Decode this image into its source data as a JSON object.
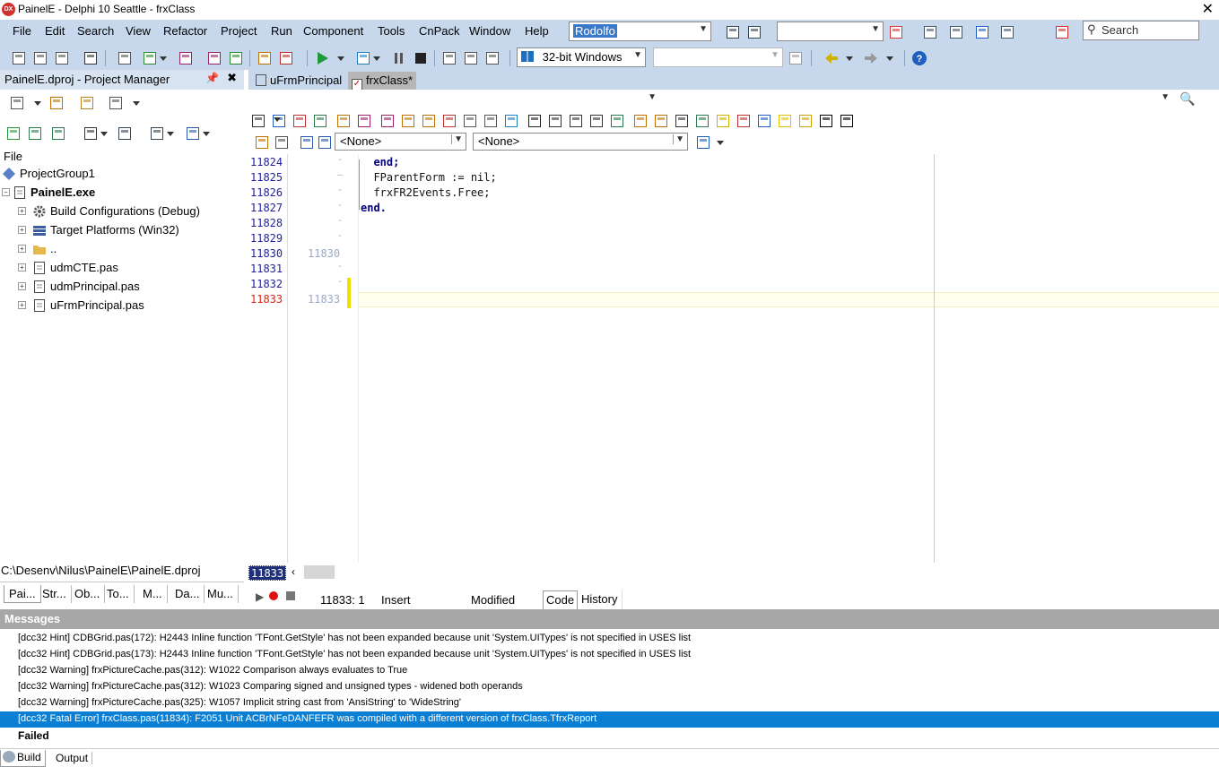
{
  "window": {
    "title": "PainelE - Delphi 10 Seattle - frxClass",
    "logo": "DX",
    "close_glyph": "✕"
  },
  "menu": [
    "File",
    "Edit",
    "Search",
    "View",
    "Refactor",
    "Project",
    "Run",
    "Component",
    "Tools",
    "CnPack",
    "Window",
    "Help"
  ],
  "toolbar": {
    "user_combo": "Rodolfo",
    "platform_combo": "32-bit Windows",
    "search_placeholder": "Search",
    "search_icon": "magnifier-icon"
  },
  "project_manager": {
    "title": "PainelE.dproj - Project Manager",
    "tree_header": "File",
    "tree": [
      {
        "label": "ProjectGroup1",
        "level": 0,
        "bold": false,
        "icon": "project-group-icon"
      },
      {
        "label": "PainelE.exe",
        "level": 1,
        "bold": true,
        "icon": "exe-icon"
      },
      {
        "label": "Build Configurations (Debug)",
        "level": 2,
        "bold": false,
        "icon": "gear-icon"
      },
      {
        "label": "Target Platforms (Win32)",
        "level": 2,
        "bold": false,
        "icon": "platform-icon"
      },
      {
        "label": "..",
        "level": 2,
        "bold": false,
        "icon": "folder-icon"
      },
      {
        "label": "udmCTE.pas",
        "level": 2,
        "bold": false,
        "icon": "pas-file-icon"
      },
      {
        "label": "udmPrincipal.pas",
        "level": 2,
        "bold": false,
        "icon": "pas-file-icon"
      },
      {
        "label": "uFrmPrincipal.pas",
        "level": 2,
        "bold": false,
        "icon": "pas-file-icon"
      }
    ],
    "path": "C:\\Desenv\\Nilus\\PainelE\\PainelE.dproj",
    "tabs": [
      "Pai...",
      "Str...",
      "Ob...",
      "To...",
      "M...",
      "Da...",
      "Mu..."
    ]
  },
  "editor": {
    "tabs": [
      {
        "label": "uFrmPrincipal",
        "active": false
      },
      {
        "label": "frxClass*",
        "active": true
      }
    ],
    "combo_intf": "<None>",
    "combo_impl": "<None>",
    "lines": [
      {
        "num": "11824",
        "text": "  end;",
        "kw": true,
        "indicator": "-",
        "alt": ""
      },
      {
        "num": "11825",
        "text": "  FParentForm := nil;",
        "kw": false,
        "indicator": "–",
        "alt": ""
      },
      {
        "num": "11826",
        "text": "  frxFR2Events.Free;",
        "kw": false,
        "indicator": "-",
        "alt": ""
      },
      {
        "num": "11827",
        "text": "end.",
        "kw": true,
        "indicator": "-",
        "alt": ""
      },
      {
        "num": "11828",
        "text": "",
        "kw": false,
        "indicator": "-",
        "alt": ""
      },
      {
        "num": "11829",
        "text": "",
        "kw": false,
        "indicator": "-",
        "alt": ""
      },
      {
        "num": "11830",
        "text": "",
        "kw": false,
        "indicator": "",
        "alt": "11830"
      },
      {
        "num": "11831",
        "text": "",
        "kw": false,
        "indicator": "-",
        "alt": ""
      },
      {
        "num": "11832",
        "text": "",
        "kw": false,
        "indicator": "-",
        "alt": ""
      },
      {
        "num": "11833",
        "text": "",
        "kw": false,
        "indicator": "",
        "alt": "11833"
      }
    ],
    "current_line_box": "11833",
    "status": {
      "position": "11833:   1",
      "mode": "Insert",
      "modified": "Modified",
      "tab_code": "Code",
      "tab_history": "History"
    }
  },
  "messages": {
    "title": "Messages",
    "items": [
      {
        "text": "[dcc32 Hint] CDBGrid.pas(172): H2443 Inline function 'TFont.GetStyle' has not been expanded because unit 'System.UITypes' is not specified in USES list",
        "selected": false
      },
      {
        "text": "[dcc32 Hint] CDBGrid.pas(173): H2443 Inline function 'TFont.GetStyle' has not been expanded because unit 'System.UITypes' is not specified in USES list",
        "selected": false
      },
      {
        "text": "[dcc32 Warning] frxPictureCache.pas(312): W1022 Comparison always evaluates to True",
        "selected": false
      },
      {
        "text": "[dcc32 Warning] frxPictureCache.pas(312): W1023 Comparing signed and unsigned types - widened both operands",
        "selected": false
      },
      {
        "text": "[dcc32 Warning] frxPictureCache.pas(325): W1057 Implicit string cast from 'AnsiString' to 'WideString'",
        "selected": false
      },
      {
        "text": "[dcc32 Fatal Error] frxClass.pas(11834): F2051 Unit ACBrNFeDANFEFR was compiled with a different version of frxClass.TfrxReport",
        "selected": true
      }
    ],
    "result": "Failed",
    "tabs": [
      "Build",
      "Output"
    ]
  }
}
